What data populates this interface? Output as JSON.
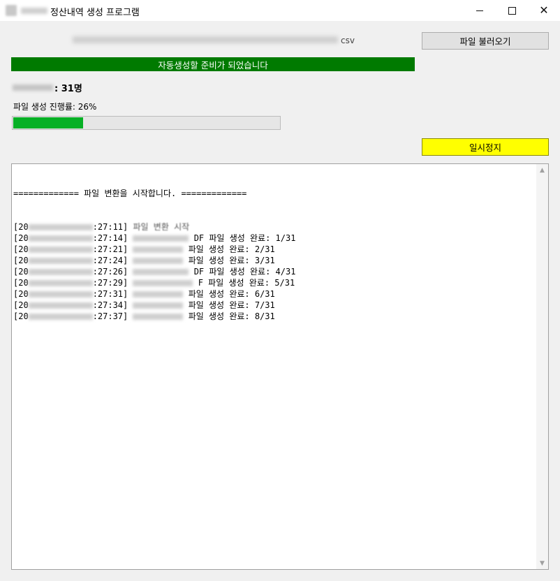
{
  "window": {
    "title": "정산내역 생성 프로그램"
  },
  "file": {
    "extension": "csv",
    "load_button_label": "파일 불러오기"
  },
  "status": {
    "banner_text": "자동생성할 준비가 되었습니다",
    "banner_color": "#007a00"
  },
  "summary": {
    "count_text": ": 31명"
  },
  "progress": {
    "label": "파일 생성 진행률: 26%",
    "fraction": 0.26,
    "fill_color": "#06b025"
  },
  "controls": {
    "pause_label": "일시정지",
    "pause_color": "#ffff00"
  },
  "log": {
    "header": "============= 파일 변환을 시작합니다. =============",
    "lines": [
      {
        "prefix": "[20",
        "time": ":27:11]",
        "message": "파일 변환 시작"
      },
      {
        "prefix": "[20",
        "time": ":27:14]",
        "message": "DF 파일 생성 완료: 1/31"
      },
      {
        "prefix": "[20",
        "time": ":27:21]",
        "message": "파일 생성 완료: 2/31"
      },
      {
        "prefix": "[20",
        "time": ":27:24]",
        "message": "파일 생성 완료: 3/31"
      },
      {
        "prefix": "[20",
        "time": ":27:26]",
        "message": "DF 파일 생성 완료: 4/31"
      },
      {
        "prefix": "[20",
        "time": ":27:29]",
        "message": "F 파일 생성 완료: 5/31"
      },
      {
        "prefix": "[20",
        "time": ":27:31]",
        "message": "파일 생성 완료: 6/31"
      },
      {
        "prefix": "[20",
        "time": ":27:34]",
        "message": "파일 생성 완료: 7/31"
      },
      {
        "prefix": "[20",
        "time": ":27:37]",
        "message": "파일 생성 완료: 8/31"
      }
    ]
  },
  "icons": {
    "minimize": "minimize-icon",
    "maximize": "maximize-icon",
    "close": "close-icon",
    "scroll_up": "scroll-up-arrow-icon",
    "scroll_down": "scroll-down-arrow-icon"
  }
}
